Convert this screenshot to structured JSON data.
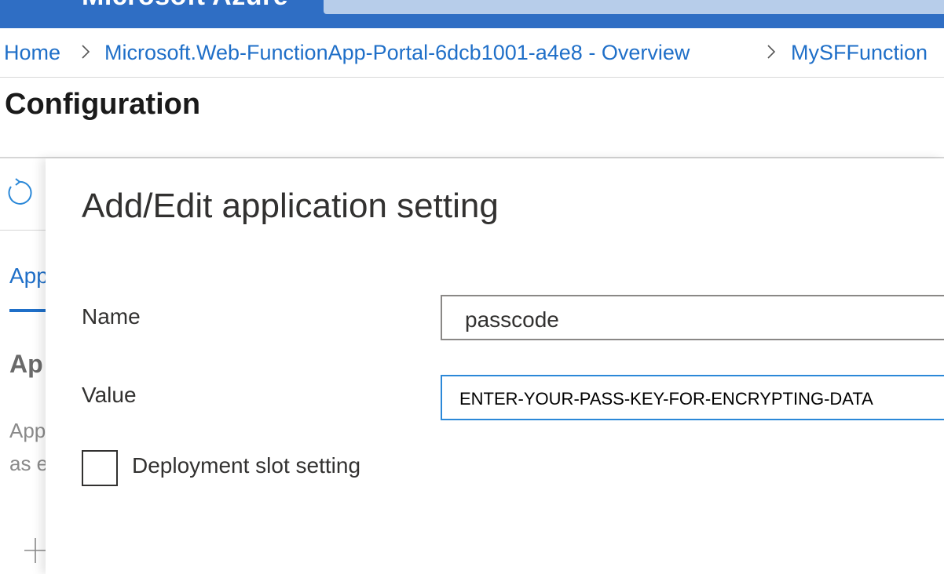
{
  "topbar": {
    "brand": "Microsoft Azure",
    "accent_color": "#2f6ec4"
  },
  "breadcrumb": {
    "items": [
      "Home",
      "Microsoft.Web-FunctionApp-Portal-6dcb1001-a4e8 - Overview",
      "MySFFunction"
    ]
  },
  "page": {
    "title": "Configuration"
  },
  "left_pane": {
    "refresh_icon": "refresh-icon",
    "tab_label": "App",
    "heading": "Ap",
    "desc_line1": "App",
    "desc_line2": "as e",
    "add_icon": "plus-icon"
  },
  "panel": {
    "title": "Add/Edit application setting",
    "name_label": "Name",
    "name_value": "passcode",
    "value_label": "Value",
    "value_value": "ENTER-YOUR-PASS-KEY-FOR-ENCRYPTING-DATA",
    "slot_setting_label": "Deployment slot setting",
    "slot_setting_checked": false
  }
}
